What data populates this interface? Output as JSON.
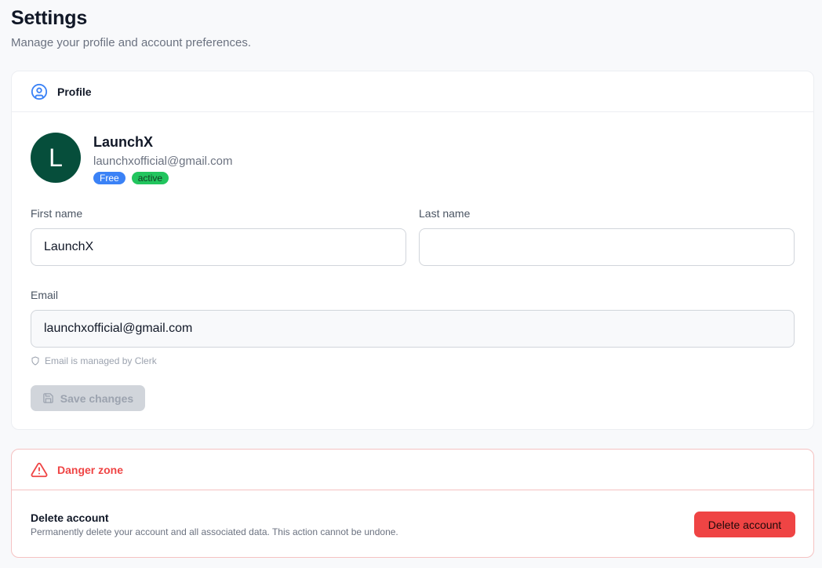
{
  "page": {
    "title": "Settings",
    "subtitle": "Manage your profile and account preferences."
  },
  "profile": {
    "header_title": "Profile",
    "header_icon": "user-circle-icon",
    "avatar_initial": "L",
    "avatar_color": "#064e3b",
    "name": "LaunchX",
    "email": "launchxofficial@gmail.com",
    "badges": {
      "plan": "Free",
      "status": "active"
    },
    "fields": {
      "first_name_label": "First name",
      "first_name_value": "LaunchX",
      "last_name_label": "Last name",
      "last_name_value": "",
      "email_label": "Email",
      "email_value": "launchxofficial@gmail.com"
    },
    "email_hint": "Email is managed by Clerk",
    "save_label": "Save changes",
    "save_disabled": true
  },
  "danger": {
    "header_title": "Danger zone",
    "header_icon": "warning-triangle-icon",
    "title": "Delete account",
    "description": "Permanently delete your account and all associated data. This action cannot be undone.",
    "delete_label": "Delete account"
  },
  "colors": {
    "accent_blue": "#3b82f6",
    "status_green": "#22c55e",
    "danger_red": "#ef4444"
  }
}
